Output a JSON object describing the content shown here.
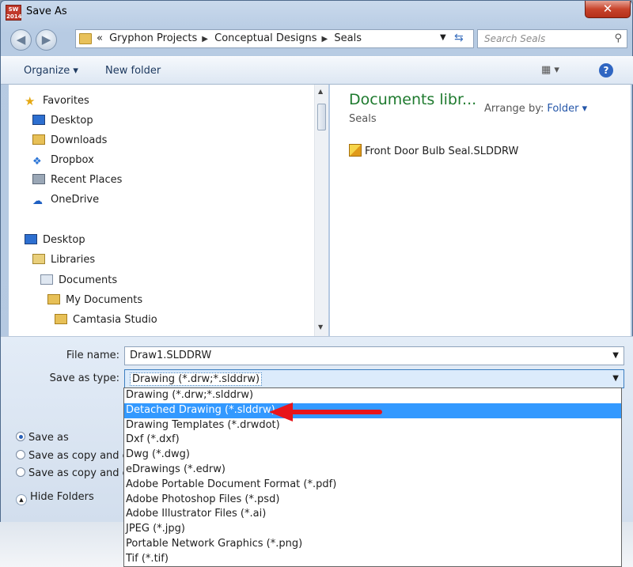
{
  "window": {
    "title": "Save As",
    "app_icon_text": "SW 2014"
  },
  "nav": {
    "breadcrumb": [
      "«",
      "Gryphon Projects",
      "Conceptual Designs",
      "Seals"
    ],
    "search_placeholder": "Search Seals"
  },
  "toolbar": {
    "organize": "Organize ▾",
    "new_folder": "New folder",
    "views": "▦ ▾",
    "help": "?"
  },
  "sidebar": {
    "favorites": "Favorites",
    "desktop_fav": "Desktop",
    "downloads": "Downloads",
    "dropbox": "Dropbox",
    "recent": "Recent Places",
    "onedrive": "OneDrive",
    "desktop": "Desktop",
    "libraries": "Libraries",
    "documents": "Documents",
    "my_documents": "My Documents",
    "camtasia": "Camtasia Studio"
  },
  "content": {
    "library_title": "Documents libr...",
    "library_sub": "Seals",
    "arrange_label": "Arrange by:",
    "arrange_value": "Folder ▾",
    "files": [
      "Front Door Bulb Seal.SLDDRW"
    ]
  },
  "form": {
    "file_name_label": "File name:",
    "file_name_value": "Draw1.SLDDRW",
    "type_label": "Save as type:",
    "type_value": "Drawing (*.drw;*.slddrw)",
    "radio_save_as": "Save as",
    "radio_copy_continue": "Save as copy and c",
    "radio_copy_open": "Save as copy and o",
    "hide_folders": "Hide Folders"
  },
  "type_options": [
    "Drawing (*.drw;*.slddrw)",
    "Detached Drawing (*.slddrw)",
    "Drawing Templates (*.drwdot)",
    "Dxf (*.dxf)",
    "Dwg (*.dwg)",
    "eDrawings (*.edrw)",
    "Adobe Portable Document Format (*.pdf)",
    "Adobe Photoshop Files (*.psd)",
    "Adobe Illustrator Files (*.ai)",
    "JPEG (*.jpg)",
    "Portable Network Graphics (*.png)",
    "Tif (*.tif)"
  ],
  "selected_option_index": 1,
  "colors": {
    "accent": "#3399ff",
    "arrow": "#e8151b",
    "library_title": "#1e7a2e"
  }
}
